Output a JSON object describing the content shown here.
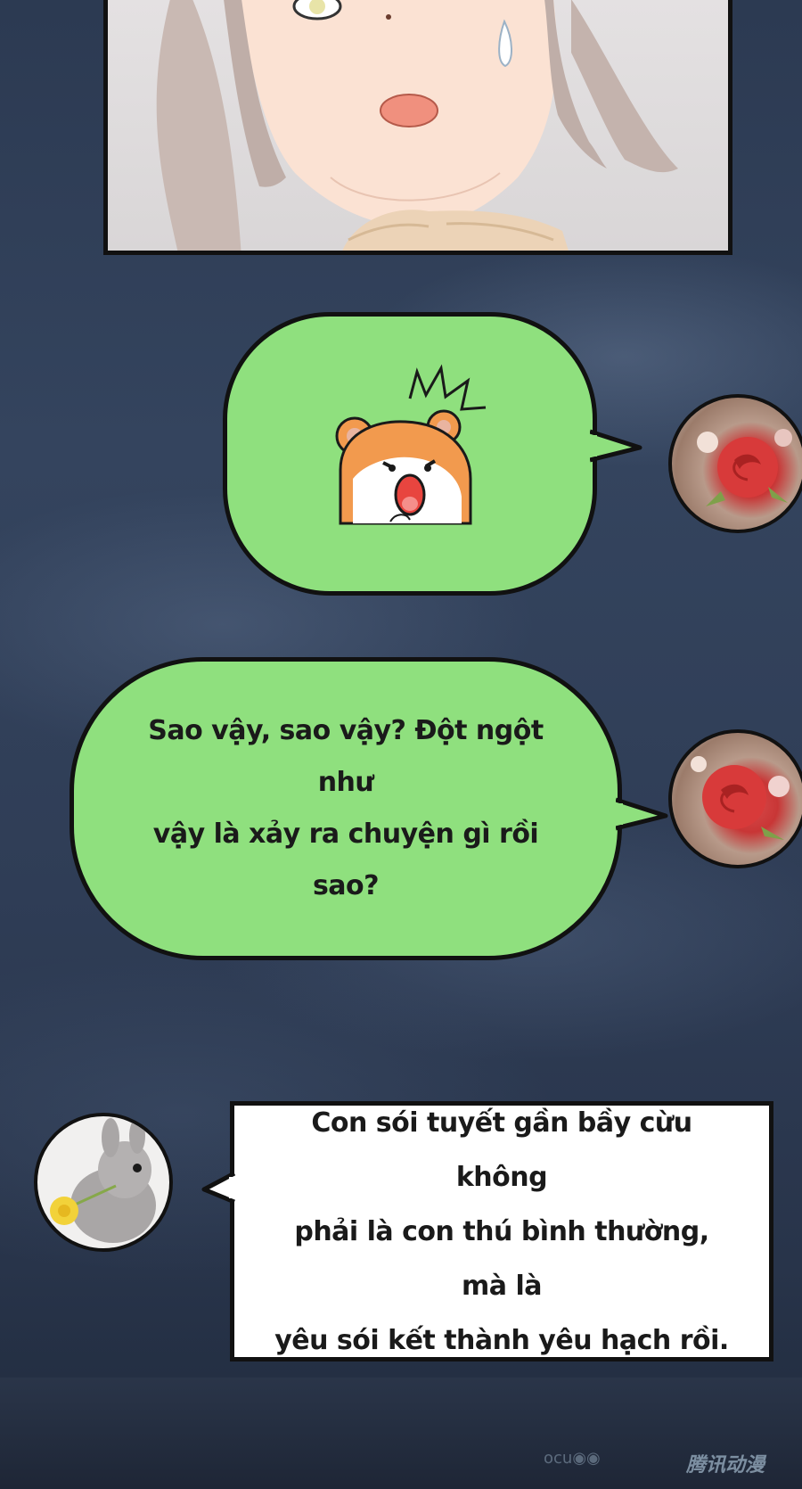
{
  "messages": [
    {
      "type": "sticker",
      "sender": "right",
      "sticker": "hamster-surprised-sticker"
    },
    {
      "type": "text",
      "sender": "right",
      "lines": [
        "Sao vậy, sao vậy? Đột ngột như",
        "vậy là xảy ra chuyện gì rồi sao?"
      ]
    },
    {
      "type": "text",
      "sender": "left",
      "lines": [
        "Con sói tuyết gần bầy cừu không",
        "phải là con thú bình thường, mà là",
        "yêu sói kết thành yêu hạch rồi."
      ]
    }
  ],
  "colors": {
    "bubble_green": "#8fe07e",
    "bubble_white": "#ffffff",
    "outline": "#111111",
    "night_sky": "#2f3d56"
  },
  "watermark": "腾讯动漫"
}
